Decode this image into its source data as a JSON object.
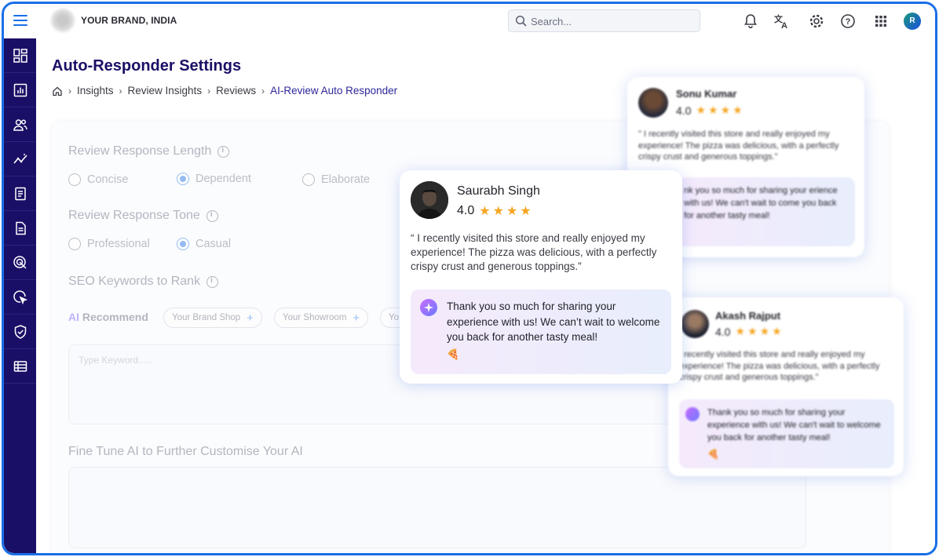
{
  "topbar": {
    "brand_name": "YOUR BRAND, INDIA",
    "search_placeholder": "Search...",
    "avatar_initial": "R",
    "icons": [
      "bell-icon",
      "translate-icon",
      "settings-icon",
      "help-icon",
      "apps-grid-icon"
    ]
  },
  "sidebar": {
    "items": [
      "dashboard-icon",
      "reports-icon",
      "users-icon",
      "analytics-icon",
      "document-icon",
      "file-icon",
      "target-icon",
      "cursor-icon",
      "shield-icon",
      "table-icon"
    ]
  },
  "page": {
    "title": "Auto-Responder Settings",
    "breadcrumb": [
      "Insights",
      "Review Insights",
      "Reviews",
      "AI-Review Auto Responder"
    ]
  },
  "settings": {
    "length": {
      "title": "Review Response Length",
      "options": [
        "Concise",
        "Dependent",
        "Elaborate"
      ],
      "selected": "Dependent"
    },
    "tone": {
      "title": "Review Response Tone",
      "options": [
        "Professional",
        "Casual"
      ],
      "selected": "Casual"
    },
    "seo": {
      "title": "SEO Keywords to Rank",
      "ai_prefix": "AI",
      "ai_label": "Recommend",
      "chips": [
        "Your Brand Shop",
        "Your Showroom",
        "Yo"
      ],
      "keyword_placeholder": "Type Keyword....."
    },
    "fine_tune": {
      "title": "Fine Tune AI to Further Customise Your AI"
    }
  },
  "reviews": [
    {
      "name": "Sonu Kumar",
      "rating": "4.0",
      "stars": "★★★★",
      "quote": "\" I recently visited this store and really enjoyed my experience! The pizza was delicious, with a perfectly crispy crust and generous toppings.\"",
      "reply": "nk you so much for sharing your erience with us! We can't wait to come you back for another tasty meal!"
    },
    {
      "name": "Saurabh Singh",
      "rating": "4.0",
      "stars": "★★★★",
      "quote": "“ I recently visited this store and really enjoyed my experience! The pizza was delicious, with a perfectly crispy crust and generous toppings.”",
      "reply": "Thank you so much for sharing your experience with us! We can’t wait to welcome you back for another tasty meal!",
      "reply_emoji": "🍕"
    },
    {
      "name": "Akash Rajput",
      "rating": "4.0",
      "stars": "★★★★",
      "quote": "I recently visited this store and really enjoyed my experience! The pizza was delicious, with a perfectly crispy crust and generous toppings.\"",
      "reply": "Thank you so much for sharing your experience with us! We can't wait to welcome you back for another tasty meal!",
      "reply_emoji": "🍕"
    }
  ]
}
